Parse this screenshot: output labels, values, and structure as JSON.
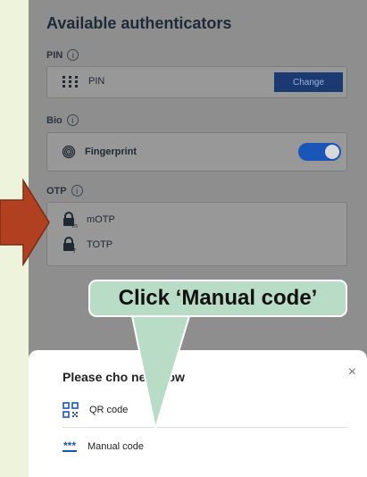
{
  "screen": {
    "title": "Available authenticators",
    "pin": {
      "label": "PIN",
      "info": "i",
      "item_label": "PIN",
      "change_label": "Change"
    },
    "bio": {
      "label": "Bio",
      "info": "i",
      "item_label": "Fingerprint",
      "toggle_on": true
    },
    "otp": {
      "label": "OTP",
      "info": "i",
      "items": [
        {
          "label": "mOTP"
        },
        {
          "label": "TOTP"
        }
      ]
    }
  },
  "sheet": {
    "title": "Please cho          ne below",
    "close": "×",
    "options": [
      {
        "icon": "qr-code-icon",
        "label": "QR code"
      },
      {
        "icon": "manual-code-icon",
        "label": "Manual code",
        "icon_text": "***"
      }
    ]
  },
  "annotation": {
    "callout": "Click ‘Manual code’"
  },
  "colors": {
    "brand_button": "#1c3a72",
    "toggle": "#1a56b8",
    "callout": "#b8dcc6",
    "arrow": "#b0401f"
  }
}
